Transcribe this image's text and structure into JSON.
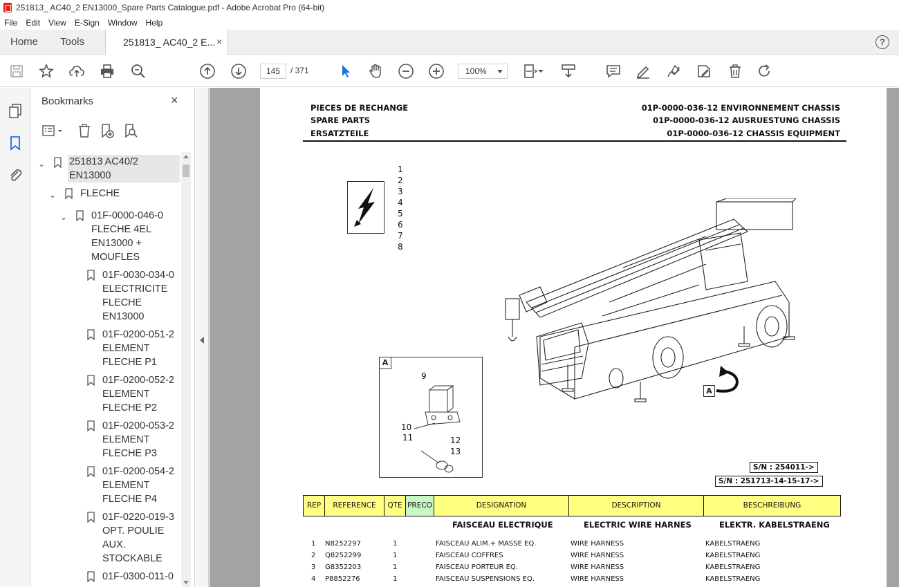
{
  "window": {
    "title": "251813_ AC40_2 EN13000_Spare Parts Catalogue.pdf - Adobe Acrobat Pro (64-bit)"
  },
  "menu": [
    "File",
    "Edit",
    "View",
    "E-Sign",
    "Window",
    "Help"
  ],
  "tabs": {
    "home": "Home",
    "tools": "Tools",
    "doc": "251813_ AC40_2 E...",
    "close": "×"
  },
  "help": "?",
  "toolbar": {
    "page_current": "145",
    "page_total": "/ 371",
    "zoom": "100%"
  },
  "bookmarks": {
    "title": "Bookmarks",
    "close": "×",
    "items": [
      {
        "label": "251813  AC40/2\nEN13000"
      },
      {
        "label": "FLECHE"
      },
      {
        "label": "01F-0000-046-0\nFLECHE 4EL\nEN13000 +\nMOUFLES"
      },
      {
        "label": "01F-0030-034-0\nELECTRICITE\nFLECHE\nEN13000"
      },
      {
        "label": "01F-0200-051-2\nELEMENT\nFLECHE P1"
      },
      {
        "label": "01F-0200-052-2\nELEMENT\nFLECHE P2"
      },
      {
        "label": "01F-0200-053-2\nELEMENT\nFLECHE P3"
      },
      {
        "label": "01F-0200-054-2\nELEMENT\nFLECHE P4"
      },
      {
        "label": "01F-0220-019-3\nOPT. POULIE\nAUX.\nSTOCKABLE"
      },
      {
        "label": "01F-0300-011-0"
      }
    ]
  },
  "document": {
    "header_left": [
      "PIECES DE RECHANGE",
      "SPARE PARTS",
      "ERSATZTEILE"
    ],
    "header_right": [
      "01P-0000-036-12 ENVIRONNEMENT CHASSIS",
      "01P-0000-036-12 AUSRUESTUNG CHASSIS",
      "01P-0000-036-12 CHASSIS EQUIPMENT"
    ],
    "item_numbers": [
      "1",
      "2",
      "3",
      "4",
      "5",
      "6",
      "7",
      "8"
    ],
    "detail_label": "A",
    "detail_numbers": [
      "9",
      "10",
      "11",
      "12",
      "13"
    ],
    "view_label": "A",
    "sn1": "S/N : 254011->",
    "sn2": "S/N : 251713-14-15-17->",
    "table_headers": [
      "REP",
      "REFERENCE",
      "QTE",
      "PRECO",
      "DESIGNATION",
      "DESCRIPTION",
      "BESCHREIBUNG"
    ],
    "section": {
      "fr": "FAISCEAU ELECTRIQUE",
      "en": "ELECTRIC WIRE HARNES",
      "de": "ELEKTR. KABELSTRAENG"
    },
    "rows": [
      {
        "rep": "1",
        "ref": "N8252297",
        "qte": "1",
        "designation": "FAISCEAU ALIM.+ MASSE  EQ.",
        "description": "WIRE HARNESS",
        "beschreibung": "KABELSTRAENG"
      },
      {
        "rep": "2",
        "ref": "Q8252299",
        "qte": "1",
        "designation": "FAISCEAU  COFFRES",
        "description": "WIRE HARNESS",
        "beschreibung": "KABELSTRAENG"
      },
      {
        "rep": "3",
        "ref": "G8352203",
        "qte": "1",
        "designation": "FAISCEAU  PORTEUR  EQ.",
        "description": "WIRE HARNESS",
        "beschreibung": "KABELSTRAENG"
      },
      {
        "rep": "4",
        "ref": "P8852276",
        "qte": "1",
        "designation": "FAISCEAU  SUSPENSIONS EQ.",
        "description": "WIRE HARNESS",
        "beschreibung": "KABELSTRAENG"
      }
    ]
  }
}
